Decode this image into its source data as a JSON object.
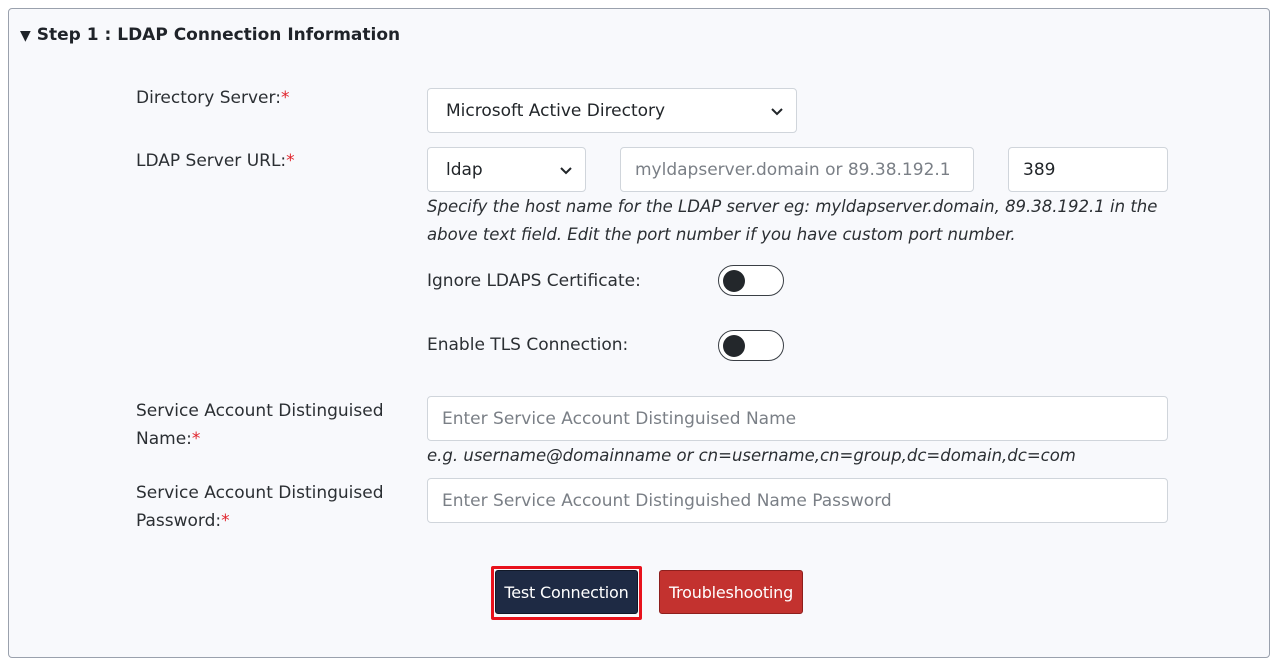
{
  "step": {
    "caret": "▼",
    "title": "Step 1 : LDAP Connection Information"
  },
  "directory_server": {
    "label": "Directory Server:",
    "required": "*",
    "selected": "Microsoft Active Directory"
  },
  "ldap_url": {
    "label": "LDAP Server URL:",
    "required": "*",
    "protocol": "ldap",
    "host_placeholder": "myldapserver.domain or 89.38.192.1",
    "port": "389",
    "help_line1": "Specify the host name for the LDAP server eg: myldapserver.domain, 89.38.192.1 in the",
    "help_line2": "above text field. Edit the port number if you have custom port number."
  },
  "toggles": {
    "ignore_ldaps": {
      "label": "Ignore LDAPS Certificate:",
      "on": false
    },
    "enable_tls": {
      "label": "Enable TLS Connection:",
      "on": false
    }
  },
  "service_dn": {
    "label_line1": "Service Account Distinguised",
    "label_line2": "Name:",
    "required": "*",
    "placeholder": "Enter Service Account Distinguised Name",
    "example": "e.g. username@domainname or cn=username,cn=group,dc=domain,dc=com"
  },
  "service_password": {
    "label_line1": "Service Account Distinguised",
    "label_line2": "Password:",
    "required": "*",
    "placeholder": "Enter Service Account Distinguished Name Password"
  },
  "buttons": {
    "test_connection": "Test Connection",
    "troubleshooting": "Troubleshooting"
  },
  "colors": {
    "test_button": "#1e2a44",
    "troubleshoot_button": "#c3322f",
    "highlight_outline": "#e8121c",
    "required_mark": "#e0242c"
  }
}
